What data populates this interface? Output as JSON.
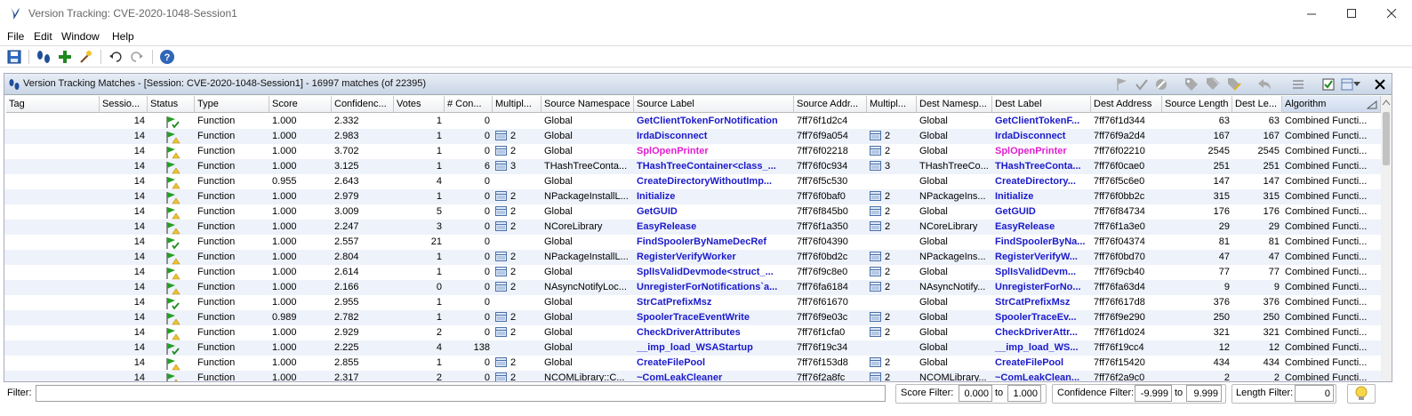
{
  "window": {
    "title": "Version Tracking: CVE-2020-1048-Session1"
  },
  "menu": [
    "File",
    "Edit",
    "Window",
    "Help"
  ],
  "panel": {
    "title": "Version Tracking Matches - [Session: CVE-2020-1048-Session1] - 16997 matches (of 22395)"
  },
  "columns": [
    "Tag",
    "Sessio...",
    "Status",
    "Type",
    "Score",
    "Confidenc...",
    "Votes",
    "# Con...",
    "Multipl...",
    "Source Namespace",
    "Source Label",
    "Source Addr...",
    "Multipl...",
    "Dest Namesp...",
    "Dest Label",
    "Dest Address",
    "Source Length",
    "Dest Le...",
    "Algorithm"
  ],
  "rows": [
    {
      "session": "14",
      "status": "accepted",
      "type": "Function",
      "score": "1.000",
      "conf": "2.332",
      "votes": "1",
      "conflicts": "0",
      "smult": "",
      "sns": "Global",
      "slabel": "GetClientTokenForNotification",
      "saddr": "7ff76f1d2c4",
      "dmult": "",
      "dns": "Global",
      "dlabel": "GetClientTokenF...",
      "daddr": "7ff76f1d344",
      "slen": "63",
      "dlen": "63",
      "algo": "Combined Functi...",
      "ext": false
    },
    {
      "session": "14",
      "status": "warn",
      "type": "Function",
      "score": "1.000",
      "conf": "2.983",
      "votes": "1",
      "conflicts": "0",
      "smult": "2",
      "sns": "Global",
      "slabel": "IrdaDisconnect",
      "saddr": "7ff76f9a054",
      "dmult": "2",
      "dns": "Global",
      "dlabel": "IrdaDisconnect",
      "daddr": "7ff76f9a2d4",
      "slen": "167",
      "dlen": "167",
      "algo": "Combined Functi...",
      "ext": false
    },
    {
      "session": "14",
      "status": "warn",
      "type": "Function",
      "score": "1.000",
      "conf": "3.702",
      "votes": "1",
      "conflicts": "0",
      "smult": "2",
      "sns": "Global",
      "slabel": "SplOpenPrinter",
      "saddr": "7ff76f02218",
      "dmult": "2",
      "dns": "Global",
      "dlabel": "SplOpenPrinter",
      "daddr": "7ff76f02210",
      "slen": "2545",
      "dlen": "2545",
      "algo": "Combined Functi...",
      "ext": true
    },
    {
      "session": "14",
      "status": "warn",
      "type": "Function",
      "score": "1.000",
      "conf": "3.125",
      "votes": "1",
      "conflicts": "6",
      "smult": "3",
      "sns": "THashTreeConta...",
      "slabel": "THashTreeContainer<class_...",
      "saddr": "7ff76f0c934",
      "dmult": "3",
      "dns": "THashTreeCo...",
      "dlabel": "THashTreeConta...",
      "daddr": "7ff76f0cae0",
      "slen": "251",
      "dlen": "251",
      "algo": "Combined Functi...",
      "ext": false
    },
    {
      "session": "14",
      "status": "warn",
      "type": "Function",
      "score": "0.955",
      "conf": "2.643",
      "votes": "4",
      "conflicts": "0",
      "smult": "",
      "sns": "Global",
      "slabel": "CreateDirectoryWithoutImp...",
      "saddr": "7ff76f5c530",
      "dmult": "",
      "dns": "Global",
      "dlabel": "CreateDirectory...",
      "daddr": "7ff76f5c6e0",
      "slen": "147",
      "dlen": "147",
      "algo": "Combined Functi...",
      "ext": false
    },
    {
      "session": "14",
      "status": "warn",
      "type": "Function",
      "score": "1.000",
      "conf": "2.979",
      "votes": "1",
      "conflicts": "0",
      "smult": "2",
      "sns": "NPackageInstallL...",
      "slabel": "Initialize",
      "saddr": "7ff76f0baf0",
      "dmult": "2",
      "dns": "NPackageIns...",
      "dlabel": "Initialize",
      "daddr": "7ff76f0bb2c",
      "slen": "315",
      "dlen": "315",
      "algo": "Combined Functi...",
      "ext": false
    },
    {
      "session": "14",
      "status": "warn",
      "type": "Function",
      "score": "1.000",
      "conf": "3.009",
      "votes": "5",
      "conflicts": "0",
      "smult": "2",
      "sns": "Global",
      "slabel": "GetGUID",
      "saddr": "7ff76f845b0",
      "dmult": "2",
      "dns": "Global",
      "dlabel": "GetGUID",
      "daddr": "7ff76f84734",
      "slen": "176",
      "dlen": "176",
      "algo": "Combined Functi...",
      "ext": false
    },
    {
      "session": "14",
      "status": "warn",
      "type": "Function",
      "score": "1.000",
      "conf": "2.247",
      "votes": "3",
      "conflicts": "0",
      "smult": "2",
      "sns": "NCoreLibrary",
      "slabel": "EasyRelease",
      "saddr": "7ff76f1a350",
      "dmult": "2",
      "dns": "NCoreLibrary",
      "dlabel": "EasyRelease",
      "daddr": "7ff76f1a3e0",
      "slen": "29",
      "dlen": "29",
      "algo": "Combined Functi...",
      "ext": false
    },
    {
      "session": "14",
      "status": "accepted",
      "type": "Function",
      "score": "1.000",
      "conf": "2.557",
      "votes": "21",
      "conflicts": "0",
      "smult": "",
      "sns": "Global",
      "slabel": "FindSpoolerByNameDecRef",
      "saddr": "7ff76f04390",
      "dmult": "",
      "dns": "Global",
      "dlabel": "FindSpoolerByNa...",
      "daddr": "7ff76f04374",
      "slen": "81",
      "dlen": "81",
      "algo": "Combined Functi...",
      "ext": false
    },
    {
      "session": "14",
      "status": "warn",
      "type": "Function",
      "score": "1.000",
      "conf": "2.804",
      "votes": "1",
      "conflicts": "0",
      "smult": "2",
      "sns": "NPackageInstallL...",
      "slabel": "RegisterVerifyWorker",
      "saddr": "7ff76f0bd2c",
      "dmult": "2",
      "dns": "NPackageIns...",
      "dlabel": "RegisterVerifyW...",
      "daddr": "7ff76f0bd70",
      "slen": "47",
      "dlen": "47",
      "algo": "Combined Functi...",
      "ext": false
    },
    {
      "session": "14",
      "status": "warn",
      "type": "Function",
      "score": "1.000",
      "conf": "2.614",
      "votes": "1",
      "conflicts": "0",
      "smult": "2",
      "sns": "Global",
      "slabel": "SplIsValidDevmode<struct_...",
      "saddr": "7ff76f9c8e0",
      "dmult": "2",
      "dns": "Global",
      "dlabel": "SplIsValidDevm...",
      "daddr": "7ff76f9cb40",
      "slen": "77",
      "dlen": "77",
      "algo": "Combined Functi...",
      "ext": false
    },
    {
      "session": "14",
      "status": "warn",
      "type": "Function",
      "score": "1.000",
      "conf": "2.166",
      "votes": "0",
      "conflicts": "0",
      "smult": "2",
      "sns": "NAsyncNotifyLoc...",
      "slabel": "UnregisterForNotifications`a...",
      "saddr": "7ff76fa6184",
      "dmult": "2",
      "dns": "NAsyncNotify...",
      "dlabel": "UnregisterForNo...",
      "daddr": "7ff76fa63d4",
      "slen": "9",
      "dlen": "9",
      "algo": "Combined Functi...",
      "ext": false
    },
    {
      "session": "14",
      "status": "accepted",
      "type": "Function",
      "score": "1.000",
      "conf": "2.955",
      "votes": "1",
      "conflicts": "0",
      "smult": "",
      "sns": "Global",
      "slabel": "StrCatPrefixMsz",
      "saddr": "7ff76f61670",
      "dmult": "",
      "dns": "Global",
      "dlabel": "StrCatPrefixMsz",
      "daddr": "7ff76f617d8",
      "slen": "376",
      "dlen": "376",
      "algo": "Combined Functi...",
      "ext": false
    },
    {
      "session": "14",
      "status": "warn",
      "type": "Function",
      "score": "0.989",
      "conf": "2.782",
      "votes": "1",
      "conflicts": "0",
      "smult": "2",
      "sns": "Global",
      "slabel": "SpoolerTraceEventWrite",
      "saddr": "7ff76f9e03c",
      "dmult": "2",
      "dns": "Global",
      "dlabel": "SpoolerTraceEv...",
      "daddr": "7ff76f9e290",
      "slen": "250",
      "dlen": "250",
      "algo": "Combined Functi...",
      "ext": false
    },
    {
      "session": "14",
      "status": "warn",
      "type": "Function",
      "score": "1.000",
      "conf": "2.929",
      "votes": "2",
      "conflicts": "0",
      "smult": "2",
      "sns": "Global",
      "slabel": "CheckDriverAttributes",
      "saddr": "7ff76f1cfa0",
      "dmult": "2",
      "dns": "Global",
      "dlabel": "CheckDriverAttr...",
      "daddr": "7ff76f1d024",
      "slen": "321",
      "dlen": "321",
      "algo": "Combined Functi...",
      "ext": false
    },
    {
      "session": "14",
      "status": "accepted",
      "type": "Function",
      "score": "1.000",
      "conf": "2.225",
      "votes": "4",
      "conflicts": "138",
      "smult": "",
      "sns": "Global",
      "slabel": "__imp_load_WSAStartup",
      "saddr": "7ff76f19c34",
      "dmult": "",
      "dns": "Global",
      "dlabel": "__imp_load_WS...",
      "daddr": "7ff76f19cc4",
      "slen": "12",
      "dlen": "12",
      "algo": "Combined Functi...",
      "ext": false
    },
    {
      "session": "14",
      "status": "warn",
      "type": "Function",
      "score": "1.000",
      "conf": "2.855",
      "votes": "1",
      "conflicts": "0",
      "smult": "2",
      "sns": "Global",
      "slabel": "CreateFilePool",
      "saddr": "7ff76f153d8",
      "dmult": "2",
      "dns": "Global",
      "dlabel": "CreateFilePool",
      "daddr": "7ff76f15420",
      "slen": "434",
      "dlen": "434",
      "algo": "Combined Functi...",
      "ext": false
    },
    {
      "session": "14",
      "status": "warn",
      "type": "Function",
      "score": "1.000",
      "conf": "2.317",
      "votes": "2",
      "conflicts": "0",
      "smult": "2",
      "sns": "NCOMLibrary::C...",
      "slabel": "~ComLeakCleaner",
      "saddr": "7ff76f2a8fc",
      "dmult": "2",
      "dns": "NCOMLibrary...",
      "dlabel": "~ComLeakClean...",
      "daddr": "7ff76f2a9c0",
      "slen": "2",
      "dlen": "2",
      "algo": "Combined Functi...",
      "ext": false
    }
  ],
  "filters": {
    "filter_label": "Filter:",
    "filter_value": "",
    "score_label": "Score Filter:",
    "score_min": "0.000",
    "to1": "to",
    "score_max": "1.000",
    "confidence_label": "Confidence Filter:",
    "conf_min": "-9.999",
    "to2": "to",
    "conf_max": "9.999",
    "length_label": "Length Filter:",
    "length_value": "0"
  },
  "colors": {
    "label_blue": "#1a1acc",
    "label_external": "#e01ed0",
    "row_alt": "#eef2fa"
  }
}
